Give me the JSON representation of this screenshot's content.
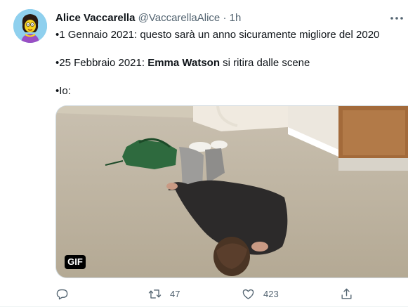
{
  "tweet": {
    "author_name": "Alice Vaccarella",
    "author_handle": "@VaccarellaAlice",
    "separator": "·",
    "time": "1h",
    "line1": "•1 Gennaio 2021: questo sarà un anno sicuramente migliore del 2020",
    "line2_prefix": "•25 Febbraio 2021: ",
    "line2_bold": "Emma Watson",
    "line2_suffix": " si ritira dalle scene",
    "line3": "•Io:",
    "media_badge": "GIF"
  },
  "actions": {
    "reply_count": "",
    "retweet_count": "47",
    "like_count": "423"
  },
  "icons": {
    "more": "more-horizontal-icon",
    "reply": "reply-icon",
    "retweet": "retweet-icon",
    "like": "heart-icon",
    "share": "share-icon"
  },
  "colors": {
    "text": "#0f1419",
    "secondary": "#536471",
    "border": "#cfd9de"
  }
}
